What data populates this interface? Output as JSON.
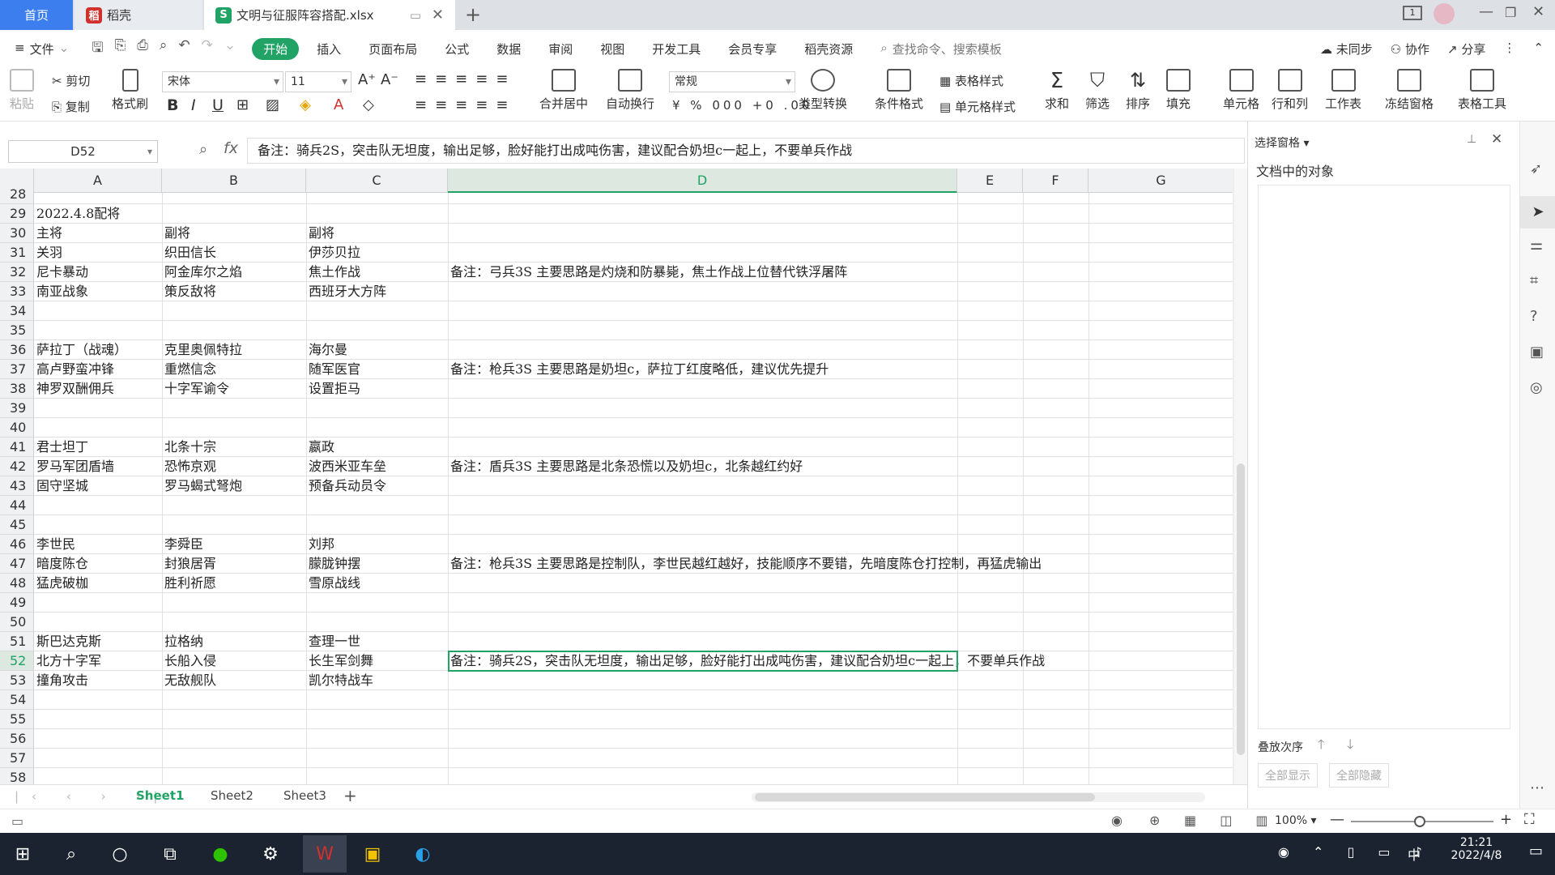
{
  "tabs": {
    "home": "首页",
    "docer": "稻壳",
    "file": "文明与征服阵容搭配.xlsx"
  },
  "menu": {
    "file": "文件",
    "items": [
      "开始",
      "插入",
      "页面布局",
      "公式",
      "数据",
      "审阅",
      "视图",
      "开发工具",
      "会员专享",
      "稻壳资源"
    ],
    "search": "查找命令、搜索模板",
    "sync": "未同步",
    "collab": "协作",
    "share": "分享"
  },
  "ribbon": {
    "paste": "粘贴",
    "cut": "剪切",
    "copy": "复制",
    "format_painter": "格式刷",
    "font": "宋体",
    "size": "11",
    "merge": "合并居中",
    "wrap": "自动换行",
    "numfmt": "常规",
    "convert": "类型转换",
    "cond": "条件格式",
    "tablestyle": "表格样式",
    "cellstyle": "单元格样式",
    "sum": "求和",
    "filter": "筛选",
    "sort": "排序",
    "fill": "填充",
    "cellbtn": "单元格",
    "rowcol": "行和列",
    "sheet": "工作表",
    "freeze": "冻结窗格",
    "tools": "表格工具"
  },
  "formula": {
    "namebox": "D52",
    "fx": "fx",
    "content": "备注：骑兵2S，突击队无坦度，输出足够，脸好能打出成吨伤害，建议配合奶坦c一起上，不要单兵作战"
  },
  "columns": [
    "A",
    "B",
    "C",
    "D",
    "E",
    "F",
    "G"
  ],
  "rows": [
    {
      "n": "28",
      "a": "",
      "b": "",
      "c": "",
      "d": ""
    },
    {
      "n": "29",
      "a": "2022.4.8配将",
      "b": "",
      "c": "",
      "d": ""
    },
    {
      "n": "30",
      "a": "主将",
      "b": "副将",
      "c": "副将",
      "d": ""
    },
    {
      "n": "31",
      "a": "关羽",
      "b": "织田信长",
      "c": "伊莎贝拉",
      "d": ""
    },
    {
      "n": "32",
      "a": "尼卡暴动",
      "b": "阿金库尔之焰",
      "c": "焦土作战",
      "d": "备注：弓兵3S 主要思路是灼烧和防暴毙，焦土作战上位替代铁浮屠阵"
    },
    {
      "n": "33",
      "a": "南亚战象",
      "b": "策反敌将",
      "c": "西班牙大方阵",
      "d": ""
    },
    {
      "n": "34",
      "a": "",
      "b": "",
      "c": "",
      "d": ""
    },
    {
      "n": "35",
      "a": "",
      "b": "",
      "c": "",
      "d": ""
    },
    {
      "n": "36",
      "a": "萨拉丁（战魂）",
      "b": "克里奥佩特拉",
      "c": "海尔曼",
      "d": ""
    },
    {
      "n": "37",
      "a": "高卢野蛮冲锋",
      "b": "重燃信念",
      "c": "随军医官",
      "d": "备注：枪兵3S 主要思路是奶坦c，萨拉丁红度略低，建议优先提升"
    },
    {
      "n": "38",
      "a": "神罗双酬佣兵",
      "b": "十字军谕令",
      "c": "设置拒马",
      "d": ""
    },
    {
      "n": "39",
      "a": "",
      "b": "",
      "c": "",
      "d": ""
    },
    {
      "n": "40",
      "a": "",
      "b": "",
      "c": "",
      "d": ""
    },
    {
      "n": "41",
      "a": "君士坦丁",
      "b": "北条十宗",
      "c": "嬴政",
      "d": ""
    },
    {
      "n": "42",
      "a": "罗马军团盾墙",
      "b": "恐怖京观",
      "c": "波西米亚车垒",
      "d": "备注：盾兵3S 主要思路是北条恐慌以及奶坦c，北条越红约好"
    },
    {
      "n": "43",
      "a": "固守坚城",
      "b": "罗马蝎式弩炮",
      "c": "预备兵动员令",
      "d": ""
    },
    {
      "n": "44",
      "a": "",
      "b": "",
      "c": "",
      "d": ""
    },
    {
      "n": "45",
      "a": "",
      "b": "",
      "c": "",
      "d": ""
    },
    {
      "n": "46",
      "a": "李世民",
      "b": "李舜臣",
      "c": "刘邦",
      "d": ""
    },
    {
      "n": "47",
      "a": "暗度陈仓",
      "b": "封狼居胥",
      "c": "朦胧钟摆",
      "d": "备注：枪兵3S 主要思路是控制队，李世民越红越好，技能顺序不要错，先暗度陈仓打控制，再猛虎输出"
    },
    {
      "n": "48",
      "a": "猛虎破枷",
      "b": "胜利祈愿",
      "c": "雪原战线",
      "d": ""
    },
    {
      "n": "49",
      "a": "",
      "b": "",
      "c": "",
      "d": ""
    },
    {
      "n": "50",
      "a": "",
      "b": "",
      "c": "",
      "d": ""
    },
    {
      "n": "51",
      "a": "斯巴达克斯",
      "b": "拉格纳",
      "c": "查理一世",
      "d": ""
    },
    {
      "n": "52",
      "a": "北方十字军",
      "b": "长船入侵",
      "c": "长生军剑舞",
      "d": "备注：骑兵2S，突击队无坦度，输出足够，脸好能打出成吨伤害，建议配合奶坦c一起上，不要单兵作战"
    },
    {
      "n": "53",
      "a": "撞角攻击",
      "b": "无敌舰队",
      "c": "凯尔特战车",
      "d": ""
    },
    {
      "n": "54",
      "a": "",
      "b": "",
      "c": "",
      "d": ""
    },
    {
      "n": "55",
      "a": "",
      "b": "",
      "c": "",
      "d": ""
    },
    {
      "n": "56",
      "a": "",
      "b": "",
      "c": "",
      "d": ""
    },
    {
      "n": "57",
      "a": "",
      "b": "",
      "c": "",
      "d": ""
    },
    {
      "n": "58",
      "a": "",
      "b": "",
      "c": "",
      "d": ""
    }
  ],
  "sheets": [
    "Sheet1",
    "Sheet2",
    "Sheet3"
  ],
  "pane": {
    "title": "选择窗格",
    "objects": "文档中的对象",
    "order": "叠放次序",
    "show_all": "全部显示",
    "hide_all": "全部隐藏"
  },
  "status": {
    "zoom": "100%"
  },
  "taskbar": {
    "time": "21:21",
    "date": "2022/4/8",
    "ime": "中"
  }
}
